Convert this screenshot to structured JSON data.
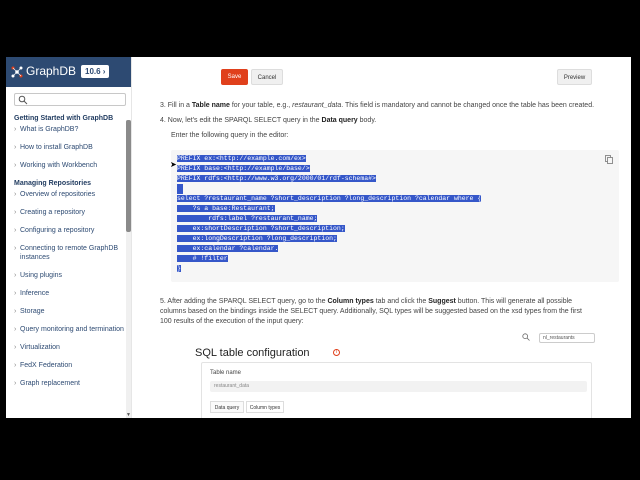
{
  "app": {
    "name": "GraphDB",
    "version": "10.6 ›"
  },
  "search": {
    "placeholder": ""
  },
  "sidebar": {
    "sections": [
      {
        "title": "Getting Started with GraphDB",
        "items": [
          "What is GraphDB?",
          "How to install GraphDB",
          "Working with Workbench"
        ]
      },
      {
        "title": "Managing Repositories",
        "items": [
          "Overview of repositories",
          "Creating a repository",
          "Configuring a repository",
          "Connecting to remote GraphDB instances",
          "Using plugins",
          "Inference",
          "Storage",
          "Query monitoring and termination",
          "Virtualization",
          "FedX Federation",
          "Graph replacement"
        ]
      }
    ]
  },
  "toolbar": {
    "save_label": "Save",
    "cancel_label": "Cancel",
    "preview_label": "Preview"
  },
  "steps": {
    "step3_prefix": "3. Fill in a ",
    "step3_bold": "Table name",
    "step3_mid": " for your table, e.g., ",
    "step3_italic": "restaurant_data",
    "step3_suffix": ". This field is mandatory and cannot be changed once the table has been created.",
    "step4_prefix": "4. Now, let's edit the SPARQL SELECT query in the ",
    "step4_bold": "Data query",
    "step4_suffix": " body.",
    "step4_sub": "Enter the following query in the editor:",
    "step5_prefix": "5. After adding the SPARQL SELECT query, go to the ",
    "step5_bold1": "Column types",
    "step5_mid": " tab and click the ",
    "step5_bold2": "Suggest",
    "step5_line1_suffix": " button. This will generate all possible",
    "step5_line2": "columns based on the bindings inside the SELECT query. Additionally, SQL types will be suggested based on the xsd types from the first",
    "step5_line3": "100 results of the execution of the input query:"
  },
  "code": {
    "lines": [
      "PREFIX ex:<http://example.com/ex>",
      "PREFIX base:<http://example/base/>",
      "PREFIX rdfs:<http://www.w3.org/2000/01/rdf-schema#>",
      "",
      "select ?restaurant_name ?short_description ?long_description ?calendar where {",
      "    ?s a base:Restaurant;",
      "        rdfs:label ?restaurant_name;",
      "    ex:shortDescription ?short_description;",
      "    ex:longDescription ?long_description;",
      "    ex:calendar ?calendar.",
      "    # !filter",
      "}"
    ]
  },
  "sql_config": {
    "title": "SQL table configuration",
    "info": "i",
    "chip": "nl_restaurants",
    "table_name_label": "Table name",
    "table_name_value": "restaurant_data",
    "tabs": [
      "Data query",
      "Column types"
    ]
  },
  "colors": {
    "brand": "#2d4a72",
    "accent": "#e0401c",
    "selection": "#3557c9"
  }
}
